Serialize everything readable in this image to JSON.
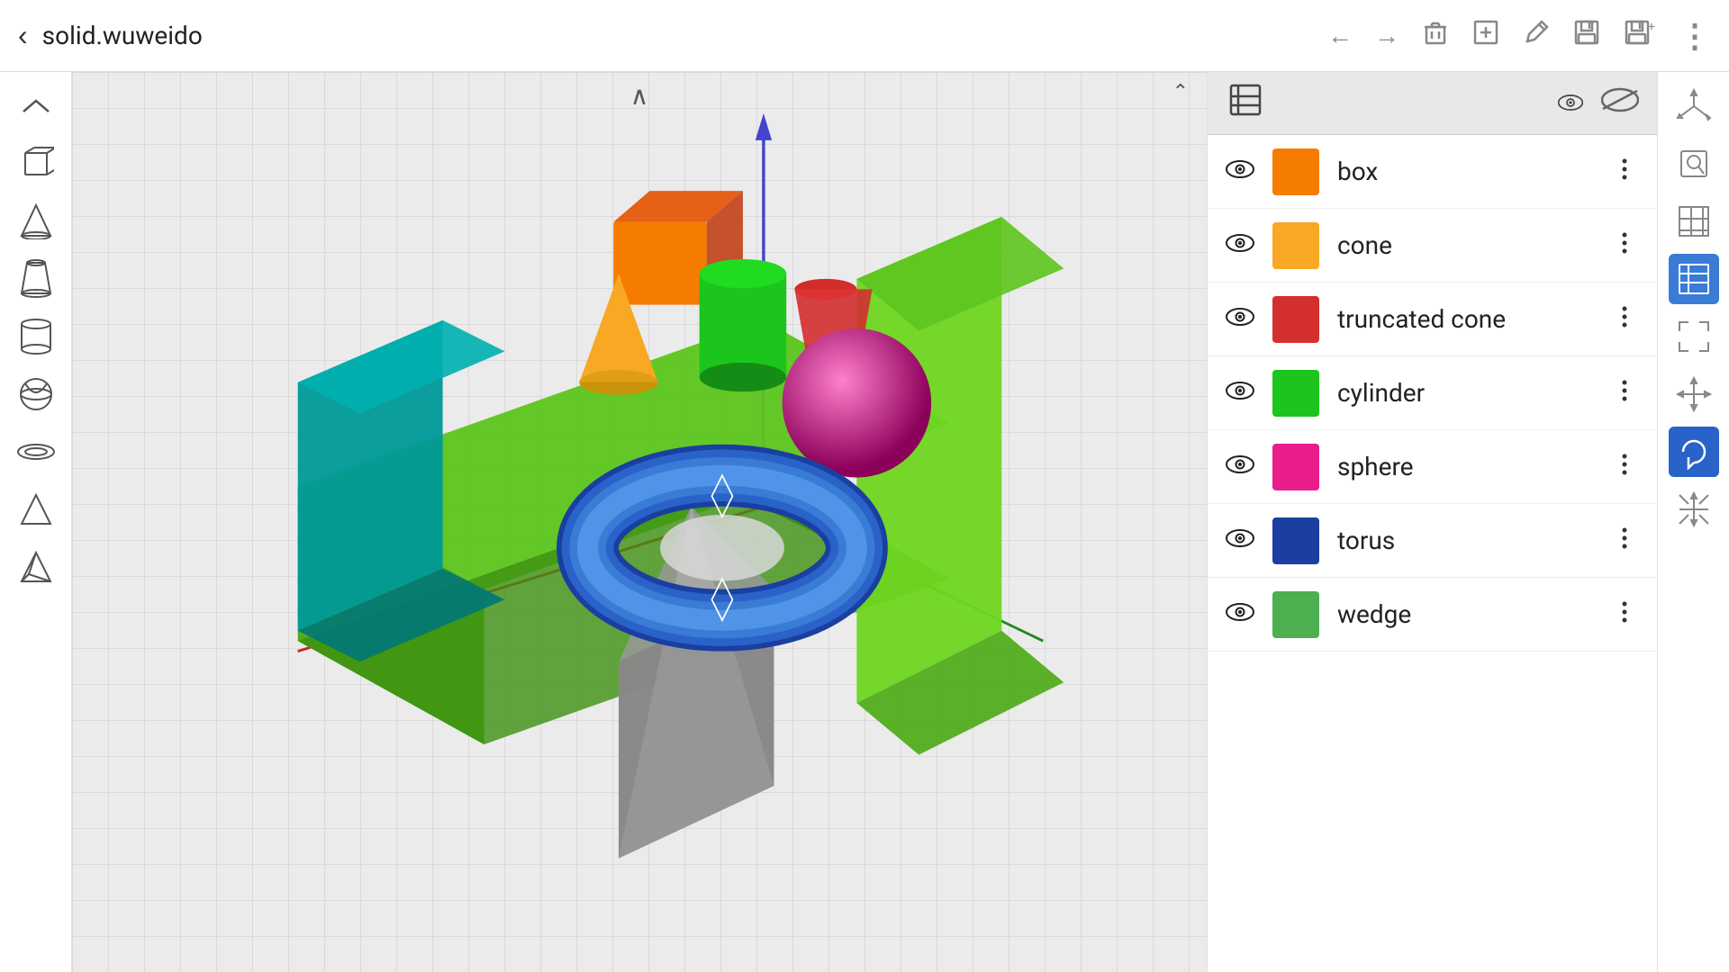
{
  "topbar": {
    "title": "solid.wuweido",
    "back_label": "‹",
    "icons": [
      "←",
      "→",
      "🗑",
      "⊞",
      "✎",
      "💾",
      "💾⁺",
      "⋮"
    ]
  },
  "left_sidebar": {
    "icons": [
      {
        "name": "collapse-icon",
        "glyph": "∧",
        "title": "Collapse"
      },
      {
        "name": "cube-icon",
        "glyph": "⬜",
        "title": "Box"
      },
      {
        "name": "cone-icon",
        "glyph": "△",
        "title": "Cone"
      },
      {
        "name": "truncated-cone-icon",
        "glyph": "⌂",
        "title": "Truncated Cone"
      },
      {
        "name": "cylinder-icon",
        "glyph": "⬭",
        "title": "Cylinder"
      },
      {
        "name": "sphere-icon",
        "glyph": "◎",
        "title": "Sphere"
      },
      {
        "name": "torus-icon",
        "glyph": "⊙",
        "title": "Torus"
      },
      {
        "name": "prism-icon",
        "glyph": "◁",
        "title": "Prism"
      },
      {
        "name": "pyramid-icon",
        "glyph": "◇",
        "title": "Pyramid"
      }
    ]
  },
  "right_sidebar": {
    "icons": [
      {
        "name": "axes-icon",
        "glyph": "⊹",
        "title": "Axes",
        "active": false
      },
      {
        "name": "search-shape-icon",
        "glyph": "⊡",
        "title": "Search Shape",
        "active": false
      },
      {
        "name": "grid-icon",
        "glyph": "⊞",
        "title": "Grid",
        "active": false
      },
      {
        "name": "layers-icon",
        "glyph": "◈",
        "title": "Layers",
        "active": true
      },
      {
        "name": "fit-icon",
        "glyph": "⛶",
        "title": "Fit",
        "active": false
      },
      {
        "name": "move-icon",
        "glyph": "✛",
        "title": "Move",
        "active": false
      },
      {
        "name": "rotate-icon",
        "glyph": "↺",
        "title": "Rotate",
        "active": true
      },
      {
        "name": "scale-icon",
        "glyph": "⤡",
        "title": "Scale",
        "active": false
      }
    ]
  },
  "panel": {
    "header": {
      "list_icon": "☰",
      "eye_icon": "👁",
      "hide_icon": "—"
    },
    "shapes": [
      {
        "id": "box",
        "label": "box",
        "color": "#f57c00",
        "visible": true
      },
      {
        "id": "cone",
        "label": "cone",
        "color": "#f9a825",
        "visible": true
      },
      {
        "id": "truncated_cone",
        "label": "truncated cone",
        "color": "#d32f2f",
        "visible": true
      },
      {
        "id": "cylinder",
        "label": "cylinder",
        "color": "#1bc51b",
        "visible": true
      },
      {
        "id": "sphere",
        "label": "sphere",
        "color": "#e91e8c",
        "visible": true
      },
      {
        "id": "torus",
        "label": "torus",
        "color": "#1a3fa0",
        "visible": true
      },
      {
        "id": "wedge",
        "label": "wedge",
        "color": "#4caf50",
        "visible": true
      }
    ]
  }
}
